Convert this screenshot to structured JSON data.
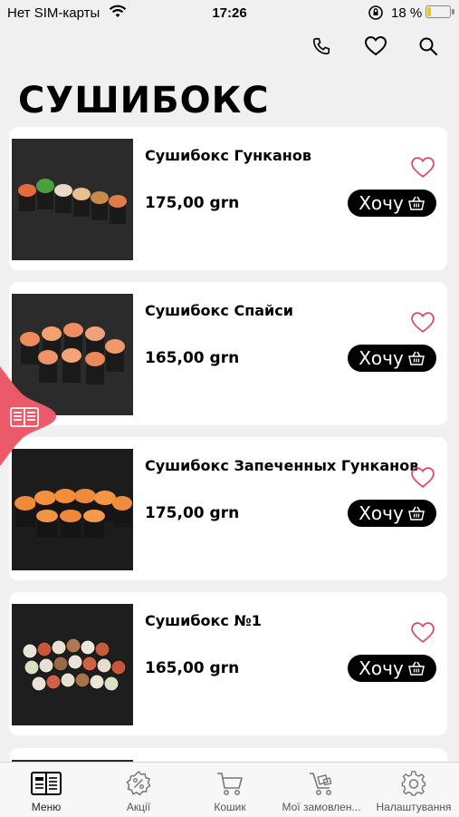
{
  "status_bar": {
    "carrier": "Нет SIM-карты",
    "time": "17:26",
    "battery": "18 %",
    "battery_level": 0.18
  },
  "page": {
    "title": "СУШИБОКС"
  },
  "products": [
    {
      "name": "Сушибокс Гунканов",
      "price": "175,00 grn",
      "button": "Хочу"
    },
    {
      "name": "Сушибокс Спайси",
      "price": "165,00 grn",
      "button": "Хочу"
    },
    {
      "name": "Сушибокс Запеченных Гунканов",
      "price": "175,00 grn",
      "button": "Хочу"
    },
    {
      "name": "Сушибокс №1",
      "price": "165,00 grn",
      "button": "Хочу"
    }
  ],
  "tabs": [
    {
      "label": "Меню",
      "icon": "menu-book-icon"
    },
    {
      "label": "Акції",
      "icon": "discount-badge-icon"
    },
    {
      "label": "Кошик",
      "icon": "cart-icon"
    },
    {
      "label": "Мої замовлен...",
      "icon": "orders-trolley-icon"
    },
    {
      "label": "Налаштування",
      "icon": "gear-icon"
    }
  ],
  "colors": {
    "accent": "#ec5a6a",
    "heart": "#e0446a",
    "button": "#000000",
    "background": "#f0f0f0"
  }
}
